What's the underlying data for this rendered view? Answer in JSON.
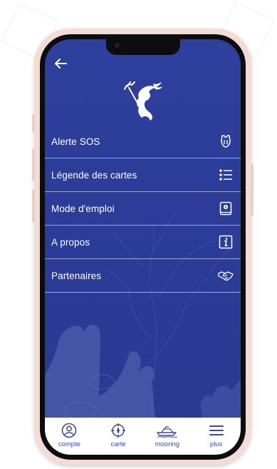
{
  "header": {
    "back_icon": "arrow-left-icon",
    "logo_icon": "mermaid-trident-logo-icon"
  },
  "menu": {
    "items": [
      {
        "label": "Alerte SOS",
        "icon": "lifejacket-icon"
      },
      {
        "label": "Légende des cartes",
        "icon": "list-icon"
      },
      {
        "label": "Mode d'emploi",
        "icon": "manual-book-icon"
      },
      {
        "label": "A propos",
        "icon": "info-icon"
      },
      {
        "label": "Partenaires",
        "icon": "handshake-icon"
      }
    ]
  },
  "tabbar": {
    "tabs": [
      {
        "label": "compte",
        "icon": "user-circle-icon"
      },
      {
        "label": "carte",
        "icon": "compass-icon"
      },
      {
        "label": "mooring",
        "icon": "boat-icon"
      },
      {
        "label": "plus",
        "icon": "menu-icon",
        "active": true
      }
    ]
  },
  "colors": {
    "screen_bg": "#2e3f9c",
    "tab_accent": "#3a4a9e",
    "phone_frame": "#f3dcd6"
  }
}
